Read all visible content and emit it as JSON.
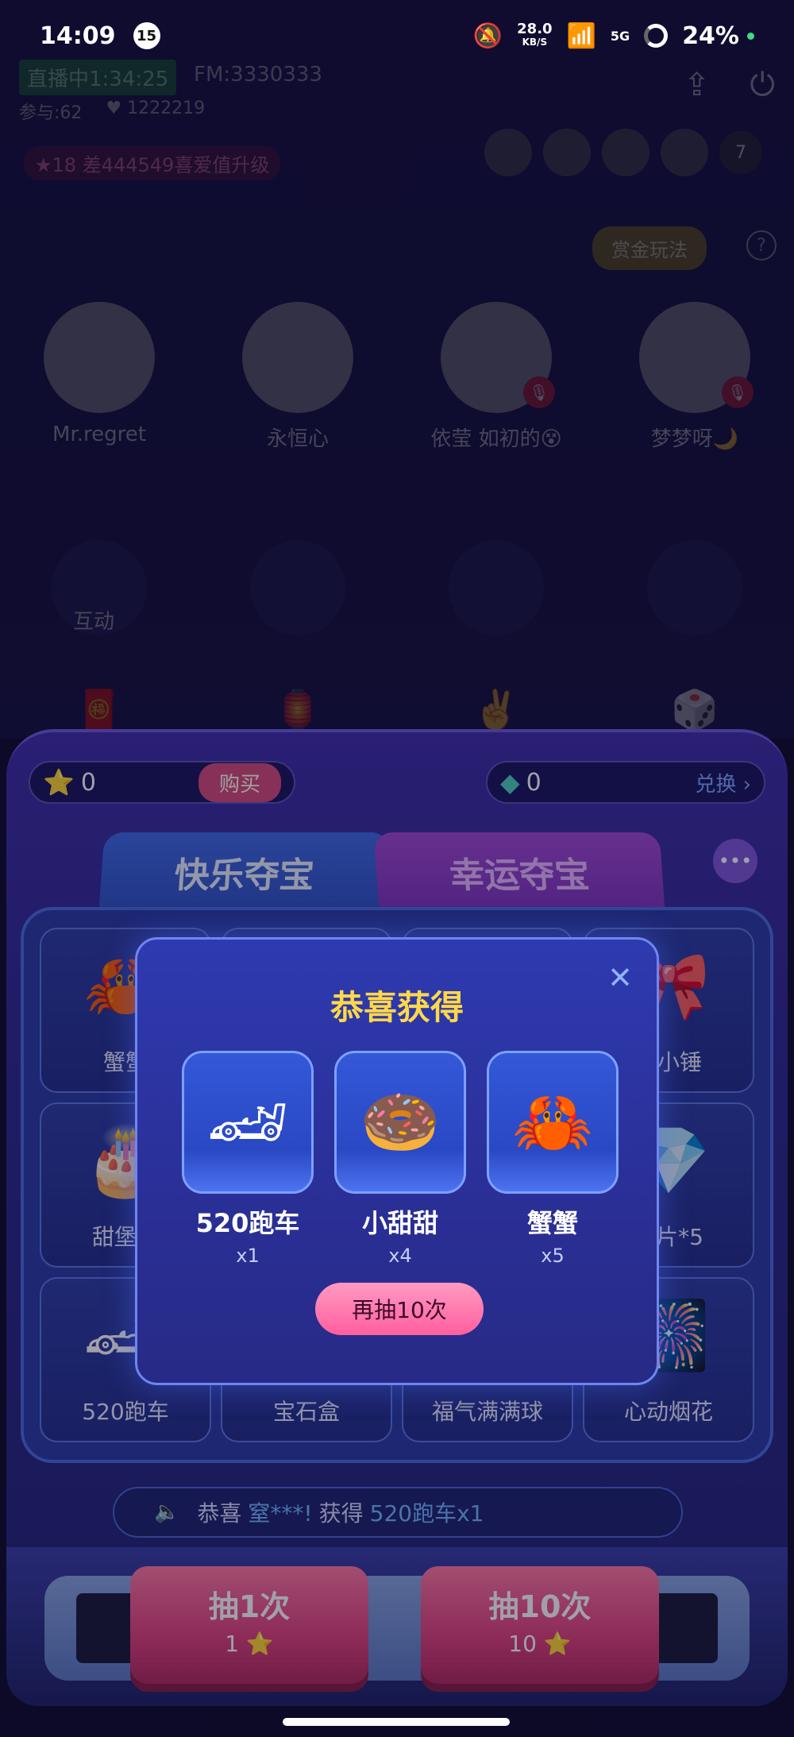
{
  "status_bar": {
    "time": "14:09",
    "notif_count": "15",
    "net_speed": "28.0",
    "net_speed_unit": "KB/S",
    "network": "5G",
    "battery": "24%"
  },
  "room": {
    "live_status": "直播中1:34:25",
    "fm": "FM:3330333",
    "participants": "参与:62",
    "likes": "1222219",
    "level": "18",
    "upgrade_text": "差444549喜爱值升级",
    "viewer_count": "7",
    "bounty_label": "赏金玩法",
    "seats": [
      {
        "name": "Mr.regret",
        "muted": false
      },
      {
        "name": "永恒心",
        "muted": false
      },
      {
        "name": "依莹 如初的😵",
        "muted": true
      },
      {
        "name": "梦梦呀🌙",
        "muted": true
      }
    ],
    "interact_label": "互动"
  },
  "panel": {
    "star_balance": "0",
    "buy_label": "购买",
    "gem_balance": "0",
    "exchange_label": "兑换",
    "tabs": [
      {
        "label": "快乐夺宝",
        "active": true
      },
      {
        "label": "幸运夺宝",
        "active": false
      }
    ],
    "grid": [
      {
        "label": "蟹蟹",
        "icon": "crab-icon"
      },
      {
        "label": "",
        "icon": "gift-icon"
      },
      {
        "label": "",
        "icon": "gift-icon"
      },
      {
        "label": "心小锤",
        "icon": "hammer-icon"
      },
      {
        "label": "甜堡狗",
        "icon": "cake-icon"
      },
      {
        "label": "",
        "icon": "gift-icon"
      },
      {
        "label": "",
        "icon": "gift-icon"
      },
      {
        "label": "碎片*5",
        "icon": "crystal-icon"
      },
      {
        "label": "520跑车",
        "icon": "car-icon"
      },
      {
        "label": "宝石盒",
        "icon": "gem-box-icon"
      },
      {
        "label": "福气满满球",
        "icon": "ball-icon"
      },
      {
        "label": "心动烟花",
        "icon": "firework-icon"
      }
    ],
    "ticker": {
      "prefix": "恭喜",
      "user": "窒***!",
      "mid": "获得",
      "prize": "520跑车x1"
    },
    "draw_buttons": [
      {
        "label": "抽1次",
        "cost": "1"
      },
      {
        "label": "抽10次",
        "cost": "10"
      }
    ]
  },
  "modal": {
    "title": "恭喜获得",
    "rewards": [
      {
        "name": "520跑车",
        "qty": "x1",
        "icon": "car-icon"
      },
      {
        "name": "小甜甜",
        "qty": "x4",
        "icon": "donut-icon"
      },
      {
        "name": "蟹蟹",
        "qty": "x5",
        "icon": "crab-icon"
      }
    ],
    "again_label": "再抽10次"
  }
}
